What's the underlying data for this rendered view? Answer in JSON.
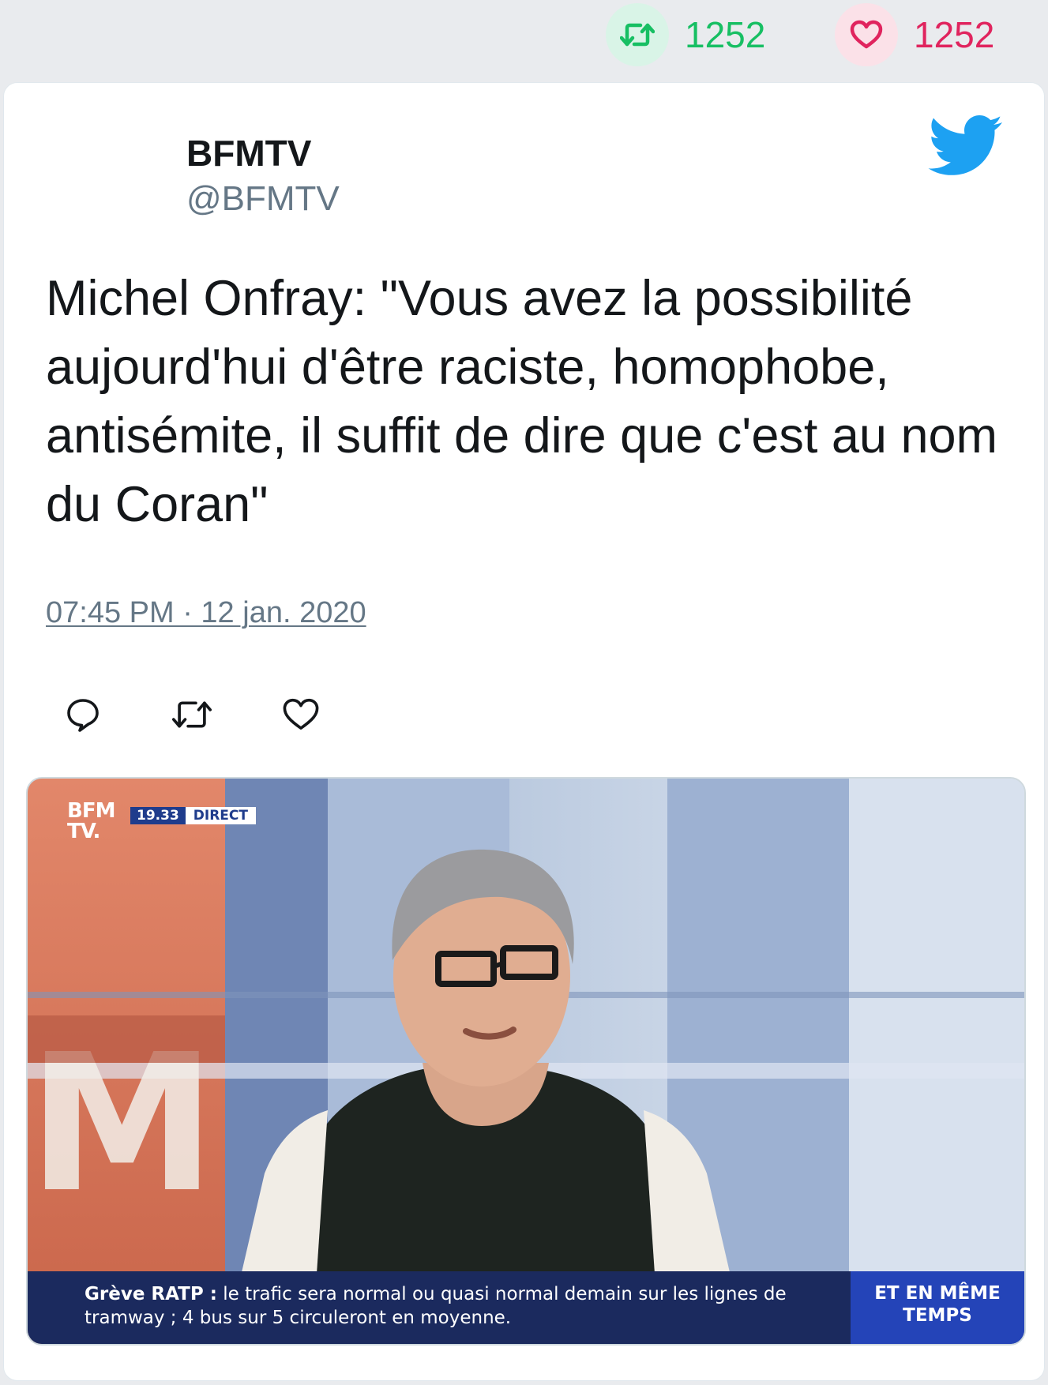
{
  "stats": {
    "retweets": "1252",
    "likes": "1252"
  },
  "tweet": {
    "author_name": "BFMTV",
    "author_handle": "@BFMTV",
    "text": "Michel Onfray: \"Vous avez la possibilité aujourd'hui d'être raciste, homophobe, antisémite, il suffit de dire que c'est au nom du Coran\"",
    "timestamp": "07:45 PM · 12 jan. 2020"
  },
  "icons": {
    "stats": [
      "retweet-icon",
      "heart-icon"
    ],
    "brand": "twitter-bird-icon",
    "actions": [
      "reply-icon",
      "retweet-icon",
      "like-icon"
    ]
  },
  "media": {
    "channel_logo_line1": "BFM",
    "channel_logo_line2": "TV.",
    "clock": "19.33",
    "live_label": "DIRECT",
    "ticker_topic": "Grève RATP :",
    "ticker_body": "le trafic sera normal ou quasi normal demain sur les lignes de tramway ; 4 bus sur 5 circuleront en moyenne.",
    "ticker_side_line1": "ET EN MÊME",
    "ticker_side_line2": "TEMPS"
  },
  "colors": {
    "retweet": "#17bf63",
    "like": "#e0245e",
    "twitter_blue": "#1da1f2",
    "muted": "#657786"
  }
}
